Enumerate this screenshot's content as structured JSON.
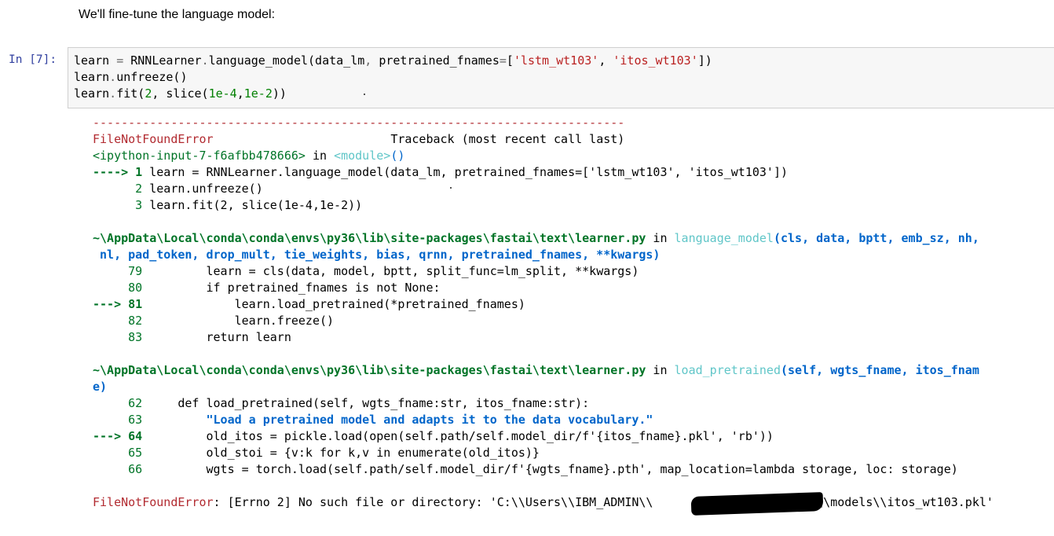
{
  "markdown": {
    "text": "We'll fine-tune the language model:"
  },
  "cell": {
    "prompt": "In [7]:",
    "code": {
      "l1": {
        "a": "learn ",
        "b": "=",
        "c": " RNNLearner",
        "d": ".",
        "e": "language_model(data_lm",
        "f": ",",
        "g": " pretrained_fnames",
        "h": "=",
        "i": "[",
        "j": "'lstm_wt103'",
        "k": ", ",
        "l": "'itos_wt103'",
        "m": "])"
      },
      "l2": {
        "a": "learn",
        "b": ".",
        "c": "unfreeze()"
      },
      "l3": {
        "a": "learn",
        "b": ".",
        "c": "fit(",
        "d": "2",
        "e": ", slice(",
        "f": "1e-4",
        "g": ",",
        "h": "1e-2",
        "i": "))"
      }
    }
  },
  "traceback": {
    "dashes": "---------------------------------------------------------------------------",
    "error_name": "FileNotFoundError",
    "spacer": "                         ",
    "header_right": "Traceback (most recent call last)",
    "input_ref": "<ipython-input-7-f6afbb478666>",
    "in_word": " in ",
    "module": "<module>",
    "module_paren": "()",
    "f1": {
      "arrow": "----> 1",
      "line1": " learn = RNNLearner.language_model(data_lm, pretrained_fnames=['lstm_wt103', 'itos_wt103'])",
      "line2_num": "      2",
      "line2": " learn.unfreeze()",
      "line3_num": "      3",
      "line3": " learn.fit(2, slice(1e-4,1e-2))"
    },
    "f2": {
      "path": "~\\AppData\\Local\\conda\\conda\\envs\\py36\\lib\\site-packages\\fastai\\text\\learner.py",
      "in_word": " in ",
      "func": "language_model",
      "args_a": "(cls, data, bptt, emb_sz, nh,",
      "args_b": " nl, pad_token, drop_mult, tie_weights, bias, qrnn, pretrained_fnames, **kwargs)",
      "n79": "     79",
      "c79": "         learn = cls(data, model, bptt, split_func=lm_split, **kwargs)",
      "n80": "     80",
      "c80": "         if pretrained_fnames is not None:",
      "n81": "---> 81",
      "c81": "             learn.load_pretrained(*pretrained_fnames)",
      "n82": "     82",
      "c82": "             learn.freeze()",
      "n83": "     83",
      "c83": "         return learn"
    },
    "f3": {
      "path": "~\\AppData\\Local\\conda\\conda\\envs\\py36\\lib\\site-packages\\fastai\\text\\learner.py",
      "in_word": " in ",
      "func": "load_pretrained",
      "args_a": "(self, wgts_fname, itos_fnam",
      "args_b": "e)",
      "n62": "     62",
      "c62": "     def load_pretrained(self, wgts_fname:str, itos_fname:str):",
      "n63": "     63",
      "c63": "         \"Load a pretrained model and adapts it to the data vocabulary.\"",
      "n64": "---> 64",
      "c64": "         old_itos = pickle.load(open(self.path/self.model_dir/f'{itos_fname}.pkl', 'rb'))",
      "n65": "     65",
      "c65": "         old_stoi = {v:k for k,v in enumerate(old_itos)}",
      "n66": "     66",
      "c66": "         wgts = torch.load(self.path/self.model_dir/f'{wgts_fname}.pth', map_location=lambda storage, loc: storage)"
    },
    "final_error": "FileNotFoundError",
    "final_msg": ": [Errno 2] No such file or directory: 'C:\\\\Users\\\\IBM_ADMIN\\\\                    ple\\\\models\\\\itos_wt103.pkl'"
  }
}
